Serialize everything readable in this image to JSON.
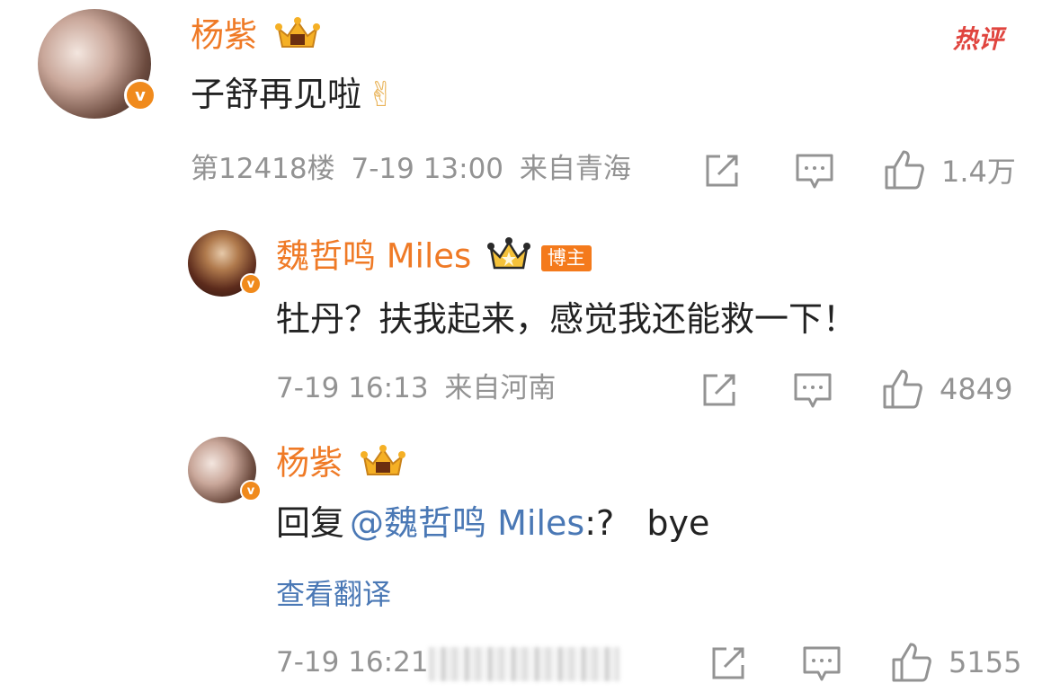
{
  "comment": {
    "username": "杨紫",
    "hot_tag": "热评",
    "text": "子舒再见啦",
    "emoji": "✌",
    "floor": "第12418楼",
    "time": "7-19 13:00",
    "location": "来自青海",
    "likes": "1.4万"
  },
  "replies": [
    {
      "username": "魏哲鸣 Miles",
      "tag": "博主",
      "text": "牡丹？扶我起来，感觉我还能救一下！",
      "time": "7-19 16:13",
      "location": "来自河南",
      "likes": "4849"
    },
    {
      "username": "杨紫",
      "reply_prefix": "回复",
      "mention": "@魏哲鸣 Miles",
      "text": ":?   bye",
      "translate": "查看翻译",
      "time": "7-19 16:21",
      "likes": "5155"
    }
  ],
  "colors": {
    "username": "#ef7a26",
    "meta": "#939393",
    "link": "#4a78b5",
    "hot": "#e0453f",
    "badge": "#f08a1c"
  },
  "icons": [
    "repost-icon",
    "comment-icon",
    "like-icon",
    "crown-icon",
    "verified-v-icon"
  ]
}
